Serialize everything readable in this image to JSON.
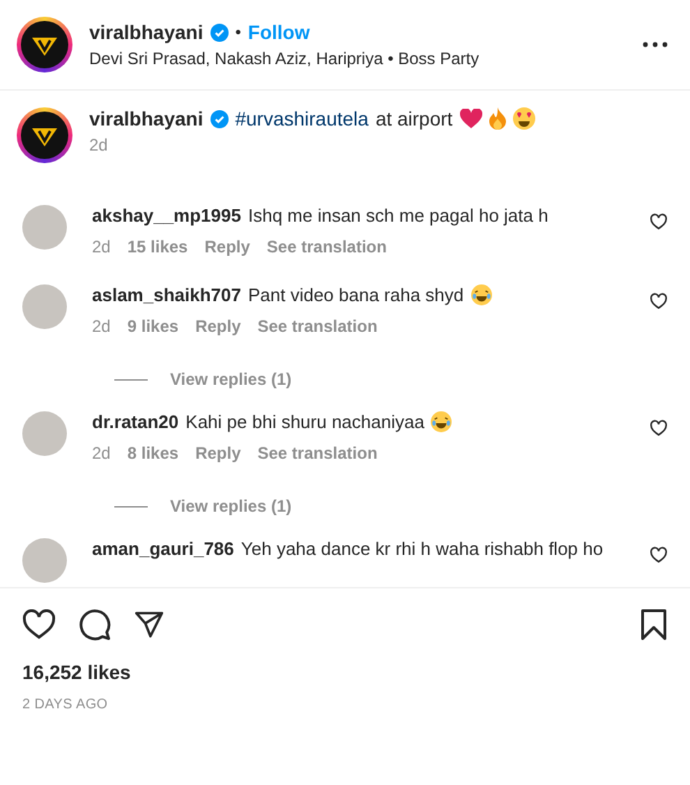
{
  "header": {
    "username": "viralbhayani",
    "verified": true,
    "separator": "•",
    "follow": "Follow",
    "audio": "Devi Sri Prasad, Nakash Aziz, Haripriya • Boss Party"
  },
  "caption": {
    "username": "viralbhayani",
    "verified": true,
    "hashtag": "#urvashirautela",
    "text": "at airport",
    "emojis": [
      {
        "kind": "heart"
      },
      {
        "kind": "fire"
      },
      {
        "kind": "heart-eyes"
      }
    ],
    "time": "2d"
  },
  "comments": [
    {
      "username": "akshay__mp1995",
      "text": "Ishq me insan sch me pagal ho jata h",
      "time": "2d",
      "likes": "15 likes",
      "reply": "Reply",
      "translation": "See translation"
    },
    {
      "username": "aslam_shaikh707",
      "text": "Pant video bana raha shyd",
      "emojis": [
        {
          "kind": "laugh"
        }
      ],
      "time": "2d",
      "likes": "9 likes",
      "reply": "Reply",
      "translation": "See translation",
      "view_replies": "View replies (1)"
    },
    {
      "username": "dr.ratan20",
      "text": "Kahi pe bhi shuru nachaniyaa",
      "emojis": [
        {
          "kind": "laugh"
        }
      ],
      "time": "2d",
      "likes": "8 likes",
      "reply": "Reply",
      "translation": "See translation",
      "view_replies": "View replies (1)"
    },
    {
      "username": "aman_gauri_786",
      "text": "Yeh yaha dance kr rhi h waha rishabh flop ho"
    }
  ],
  "actions": {
    "likes": "16,252 likes",
    "time": "2 DAYS AGO"
  }
}
